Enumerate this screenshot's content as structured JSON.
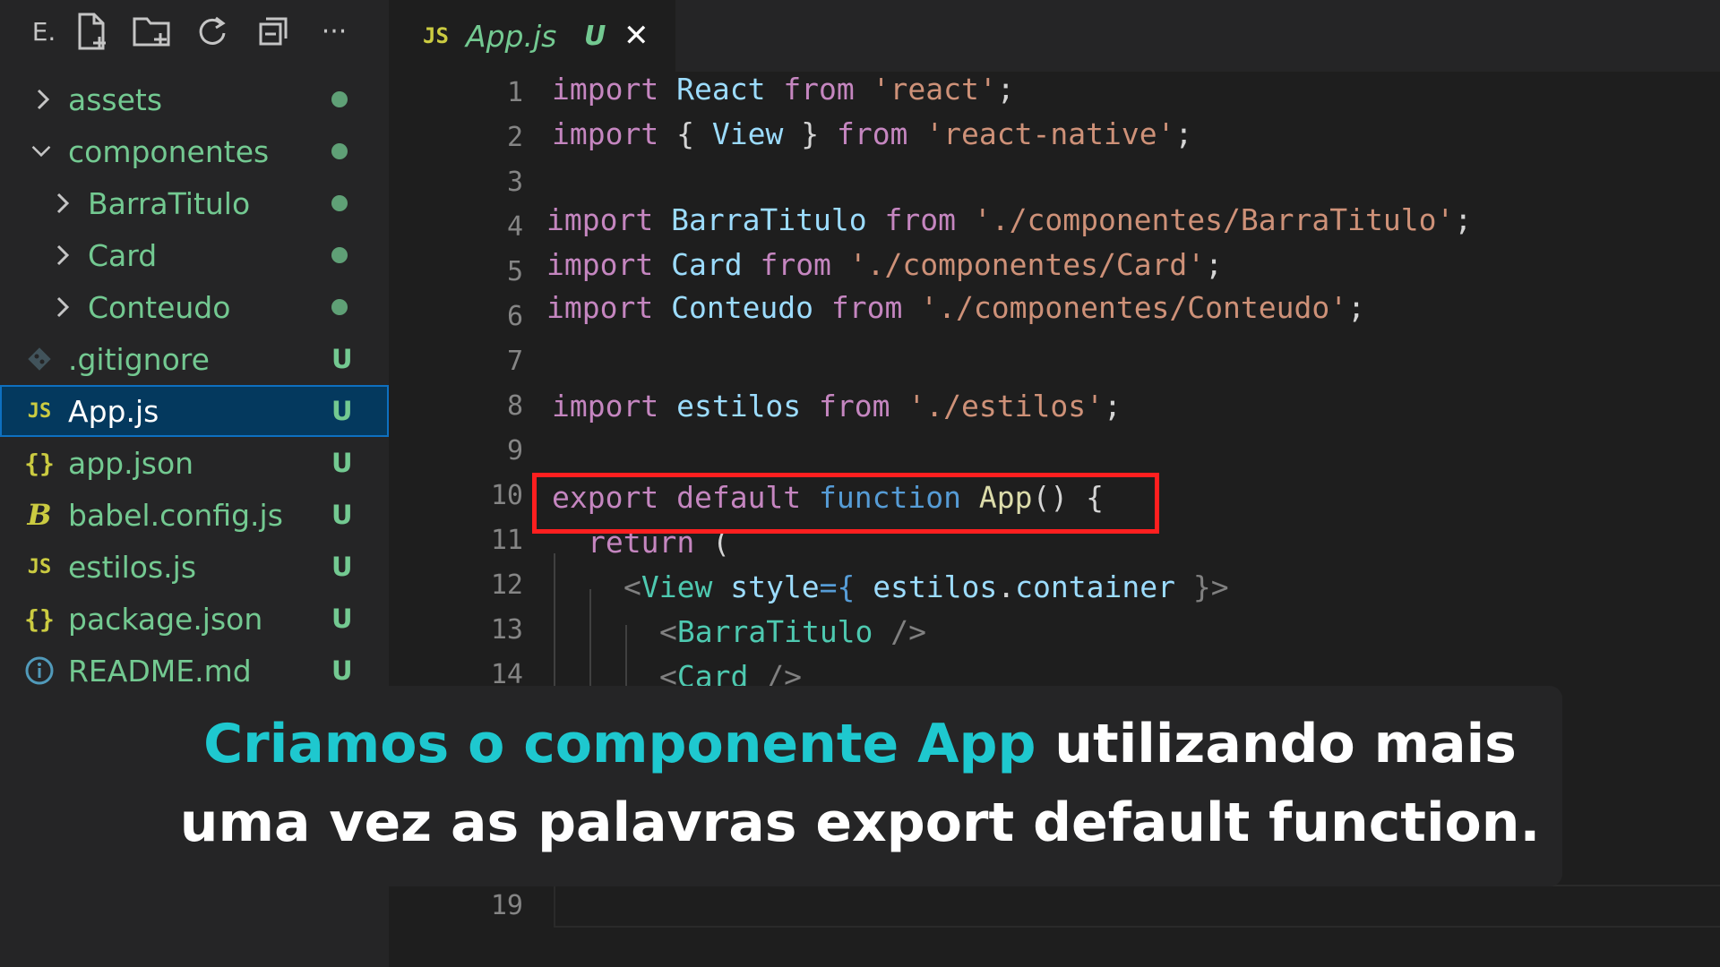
{
  "sidebar": {
    "toolbar_label": "E.",
    "toolbar_icons": [
      "new-file-icon",
      "new-folder-icon",
      "refresh-icon",
      "collapse-all-icon",
      "more-icon"
    ],
    "more_label": "···",
    "items": [
      {
        "label": "assets",
        "type": "folder",
        "expanded": false,
        "status": "dot"
      },
      {
        "label": "componentes",
        "type": "folder",
        "expanded": true,
        "status": "dot"
      },
      {
        "label": "BarraTitulo",
        "type": "folder",
        "expanded": false,
        "status": "dot"
      },
      {
        "label": "Card",
        "type": "folder",
        "expanded": false,
        "status": "dot"
      },
      {
        "label": "Conteudo",
        "type": "folder",
        "expanded": false,
        "status": "dot"
      },
      {
        "label": ".gitignore",
        "type": "file",
        "icon": "git-icon",
        "status": "U"
      },
      {
        "label": "App.js",
        "type": "file",
        "icon": "js-icon",
        "status": "U",
        "selected": true
      },
      {
        "label": "app.json",
        "type": "file",
        "icon": "json-icon",
        "status": "U"
      },
      {
        "label": "babel.config.js",
        "type": "file",
        "icon": "babel-icon",
        "status": "U"
      },
      {
        "label": "estilos.js",
        "type": "file",
        "icon": "js-icon",
        "status": "U"
      },
      {
        "label": "package.json",
        "type": "file",
        "icon": "json-icon",
        "status": "U"
      },
      {
        "label": "README.md",
        "type": "file",
        "icon": "info-icon",
        "status": "U"
      }
    ],
    "icon_glyphs": {
      "js": "JS",
      "json": "{}",
      "babel": "B",
      "info": "i"
    }
  },
  "editor": {
    "tab": {
      "icon": "JS",
      "name": "App.js",
      "badge": "U",
      "close": "✕"
    },
    "line_numbers": [
      "1",
      "2",
      "3",
      "4",
      "5",
      "6",
      "7",
      "8",
      "9",
      "10",
      "11",
      "12",
      "13",
      "14",
      "19"
    ],
    "lines": {
      "l1": {
        "a": "import",
        "b": "React",
        "c": "from",
        "d": "'react'",
        "e": ";"
      },
      "l2": {
        "a": "import",
        "b": "{",
        "c": "View",
        "d": "}",
        "e": "from",
        "f": "'react-native'",
        "g": ";"
      },
      "l4": {
        "a": "import",
        "b": "BarraTitulo",
        "c": "from",
        "d": "'./componentes/BarraTitulo'",
        "e": ";"
      },
      "l5": {
        "a": "import",
        "b": "Card",
        "c": "from",
        "d": "'./componentes/Card'",
        "e": ";"
      },
      "l6": {
        "a": "import",
        "b": "Conteudo",
        "c": "from",
        "d": "'./componentes/Conteudo'",
        "e": ";"
      },
      "l8": {
        "a": "import",
        "b": "estilos",
        "c": "from",
        "d": "'./estilos'",
        "e": ";"
      },
      "l10": {
        "a": "export",
        "b": "default",
        "c": "function",
        "d": "App",
        "e": "() {"
      },
      "l11": {
        "a": "return",
        "b": "("
      },
      "l12": {
        "a": "<",
        "b": "View",
        "c": "style",
        "d": "={",
        "e": "estilos",
        "f": ".",
        "g": "container",
        "h": "}>"
      },
      "l13": {
        "a": "<",
        "b": "BarraTitulo",
        "c": "/>"
      },
      "l14": {
        "a": "<",
        "b": "Card",
        "c": "/>"
      }
    }
  },
  "caption": {
    "accent": "Criamos o componente App",
    "rest1": " utilizando mais",
    "line2": "uma vez as palavras export default function."
  },
  "colors": {
    "git_untracked": "#73c991",
    "caption_accent": "#1ec8cf",
    "highlight_box": "#ff1f1f",
    "selection": "#04395e"
  }
}
